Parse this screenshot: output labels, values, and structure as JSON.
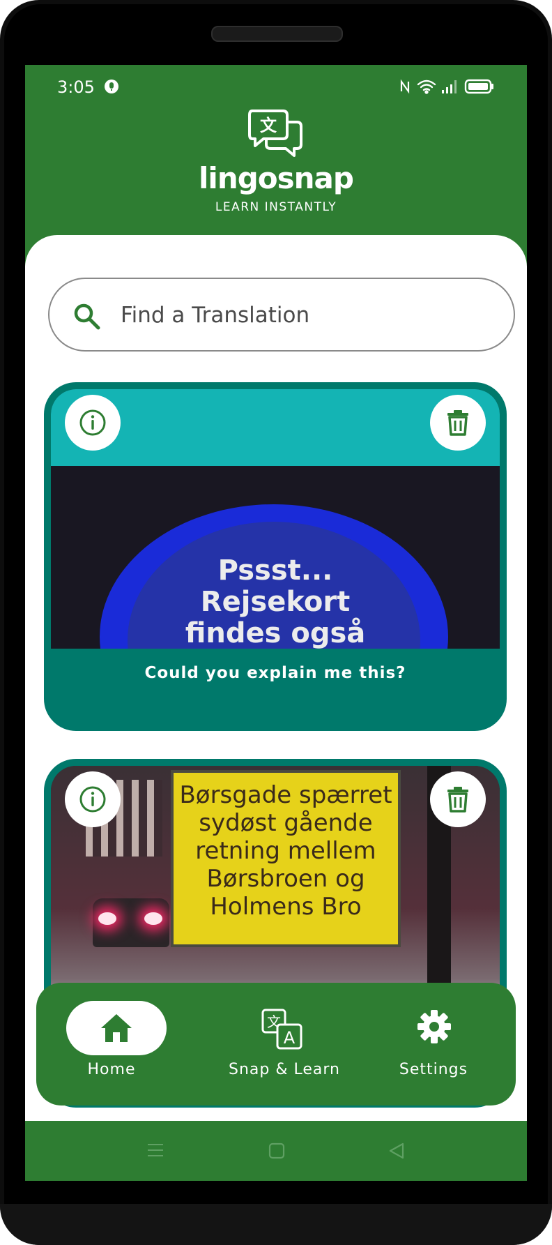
{
  "status_bar": {
    "time": "3:05",
    "icons": [
      "alert-icon",
      "nfc-icon",
      "wifi-icon",
      "signal-icon",
      "battery-icon"
    ]
  },
  "app": {
    "name": "lingosnap",
    "tagline": "LEARN INSTANTLY"
  },
  "search": {
    "placeholder": "Find a Translation",
    "value": ""
  },
  "cards": [
    {
      "image_text": [
        "Pssst...",
        "Rejsekort",
        "findes også"
      ],
      "caption": "Could you explain me this?"
    },
    {
      "image_text": [
        "Børsgade spærret",
        "sydøst gående",
        "retning mellem",
        "Børsbroen og",
        "Holmens Bro"
      ],
      "caption": ""
    }
  ],
  "bottom_nav": {
    "home": "Home",
    "snap": "Snap & Learn",
    "settings": "Settings",
    "active": "home"
  },
  "colors": {
    "primary": "#2e7d32",
    "card": "#00796b",
    "surface": "#ffffff"
  }
}
